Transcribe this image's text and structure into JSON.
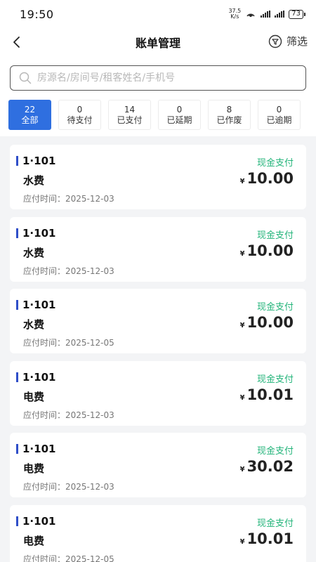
{
  "status_bar": {
    "time": "19:50",
    "net_speed_value": "37.5",
    "net_speed_unit": "K/s",
    "battery": "73"
  },
  "nav": {
    "title": "账单管理",
    "filter_label": "筛选"
  },
  "search": {
    "placeholder": "房源名/房间号/租客姓名/手机号",
    "value": ""
  },
  "tabs": [
    {
      "count": "22",
      "label": "全部",
      "active": true
    },
    {
      "count": "0",
      "label": "待支付",
      "active": false
    },
    {
      "count": "14",
      "label": "已支付",
      "active": false
    },
    {
      "count": "0",
      "label": "已延期",
      "active": false
    },
    {
      "count": "8",
      "label": "已作废",
      "active": false
    },
    {
      "count": "0",
      "label": "已逾期",
      "active": false
    }
  ],
  "bills": [
    {
      "room": "1·101",
      "type": "水费",
      "pay_method": "现金支付",
      "currency": "¥",
      "amount": "10.00",
      "date_label": "应付时间：",
      "date": "2025-12-03"
    },
    {
      "room": "1·101",
      "type": "水费",
      "pay_method": "现金支付",
      "currency": "¥",
      "amount": "10.00",
      "date_label": "应付时间：",
      "date": "2025-12-03"
    },
    {
      "room": "1·101",
      "type": "水费",
      "pay_method": "现金支付",
      "currency": "¥",
      "amount": "10.00",
      "date_label": "应付时间：",
      "date": "2025-12-05"
    },
    {
      "room": "1·101",
      "type": "电费",
      "pay_method": "现金支付",
      "currency": "¥",
      "amount": "10.01",
      "date_label": "应付时间：",
      "date": "2025-12-03"
    },
    {
      "room": "1·101",
      "type": "电费",
      "pay_method": "现金支付",
      "currency": "¥",
      "amount": "30.02",
      "date_label": "应付时间：",
      "date": "2025-12-03"
    },
    {
      "room": "1·101",
      "type": "电费",
      "pay_method": "现金支付",
      "currency": "¥",
      "amount": "10.01",
      "date_label": "应付时间：",
      "date": "2025-12-05"
    }
  ],
  "colors": {
    "accent": "#2f6fe0",
    "pay_method": "#23b47a",
    "room_marker": "#2f4ec8"
  }
}
